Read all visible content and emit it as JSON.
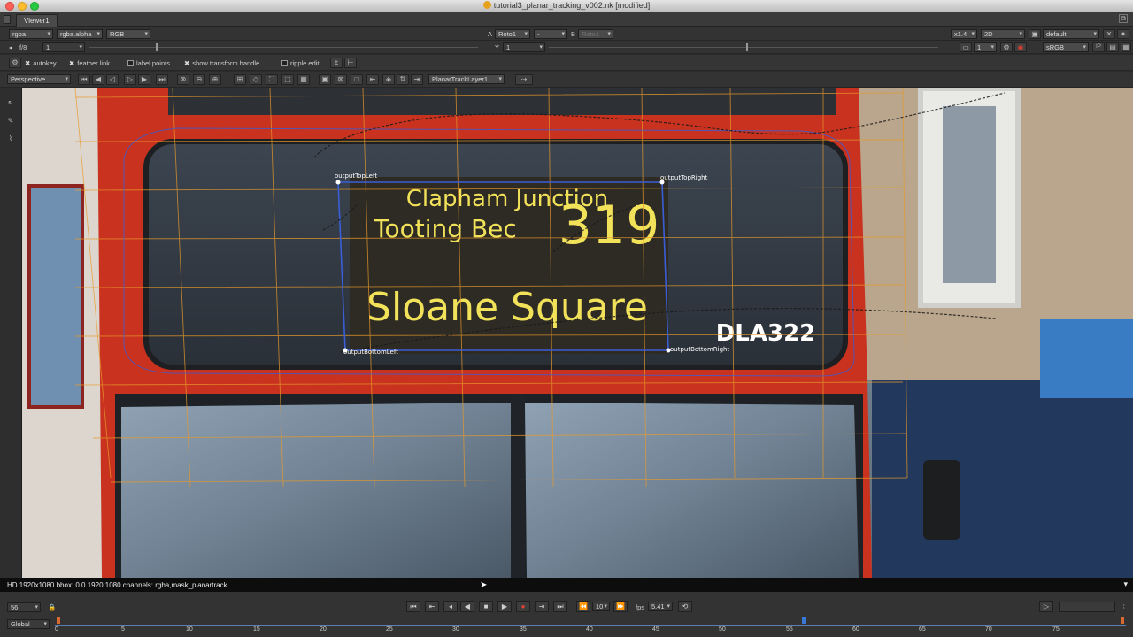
{
  "window": {
    "title": "tutorial3_planar_tracking_v002.nk [modified]"
  },
  "tabs": {
    "viewer": "Viewer1"
  },
  "toolbar1": {
    "channels": "rgba",
    "alpha": "rgba.alpha",
    "display": "RGB",
    "a_label": "A",
    "a_input": "Roto1",
    "mid_dropdown": "-",
    "b_label": "B",
    "b_input": "Roto1",
    "zoom": "x1.4",
    "view_mode": "2D",
    "lut": "default"
  },
  "toolbar2": {
    "fstop": "f/8",
    "frame_a": "1",
    "y_label": "Y",
    "y_value": "1",
    "proxy": "1",
    "colorspace": "sRGB"
  },
  "toolbar3": {
    "autokey": "autokey",
    "feather_link": "feather link",
    "label_points": "label points",
    "show_transform_handle": "show transform handle",
    "ripple_edit": "ripple edit"
  },
  "toolbar4": {
    "view_mode": "Perspective",
    "track_layer": "PlanarTrackLayer1"
  },
  "viewer": {
    "sign_line1": "Clapham Junction",
    "sign_line2": "Tooting Bec",
    "sign_number": "319",
    "sign_destination": "Sloane Square",
    "registration": "DLA322",
    "corner_tl": "outputTopLeft",
    "corner_tr": "outputTopRight",
    "corner_bl": "outputBottomLeft",
    "corner_br": "outputBottomRight"
  },
  "info": {
    "text": "HD 1920x1080 bbox: 0 0 1920 1080 channels: rgba,mask_planartrack"
  },
  "timeline": {
    "current_frame": "56",
    "step": "10",
    "fps_label": "fps",
    "fps_value": "5.41",
    "scope": "Global",
    "ticks": [
      "0",
      "5",
      "10",
      "15",
      "20",
      "25",
      "30",
      "35",
      "40",
      "45",
      "50",
      "55",
      "60",
      "65",
      "70",
      "75"
    ]
  },
  "colors": {
    "accent_orange": "#e89a2a",
    "track_blue": "#3a5ed8",
    "bus_red": "#c8321f",
    "sign_yellow": "#f2e25a"
  }
}
